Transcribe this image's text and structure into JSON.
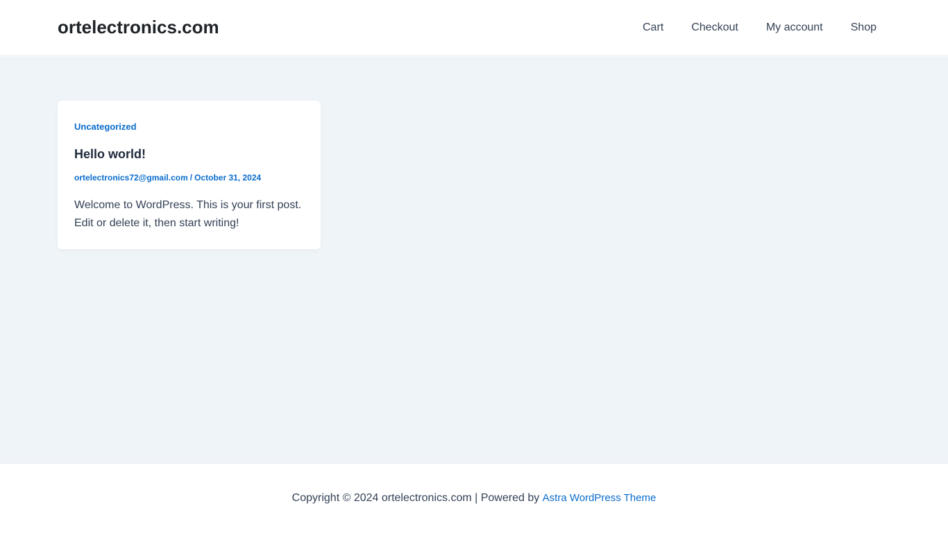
{
  "header": {
    "site_title": "ortelectronics.com",
    "nav": [
      {
        "label": "Cart"
      },
      {
        "label": "Checkout"
      },
      {
        "label": "My account"
      },
      {
        "label": "Shop"
      }
    ]
  },
  "post": {
    "category": "Uncategorized",
    "title": "Hello world!",
    "author": "ortelectronics72@gmail.com",
    "separator": "/",
    "date": "October 31, 2024",
    "excerpt": "Welcome to WordPress. This is your first post. Edit or delete it, then start writing!"
  },
  "footer": {
    "copyright": "Copyright © 2024 ortelectronics.com | Powered by ",
    "theme_link": "Astra WordPress Theme"
  },
  "colors": {
    "accent": "#0a6ccc",
    "content_bg": "#eff4f8",
    "text": "#334155",
    "heading": "#1e293b"
  }
}
